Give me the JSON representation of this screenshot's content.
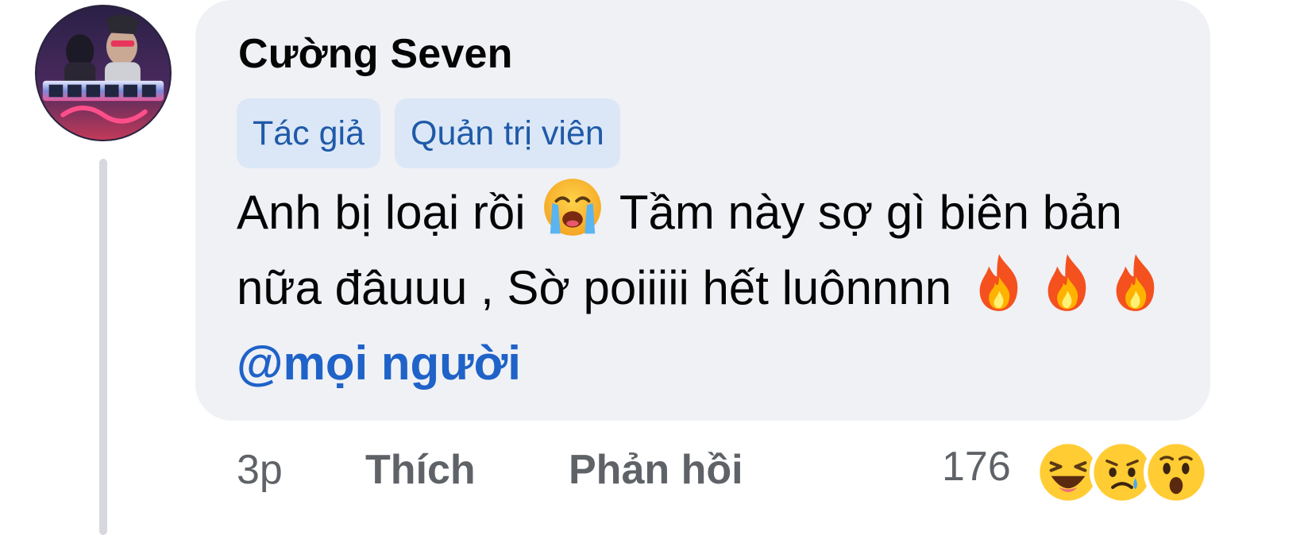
{
  "comment": {
    "author": "Cường Seven",
    "badges": [
      "Tác giả",
      "Quản trị viên"
    ],
    "text_part1": "Anh bị loại rồi",
    "text_part2": "Tầm này sợ gì biên bản nữa đâuuu , Sờ poiiiii hết luônnnn",
    "mention": "@mọi người",
    "inline_emojis": [
      "crying-face",
      "fire",
      "fire",
      "fire"
    ]
  },
  "footer": {
    "time": "3p",
    "like_label": "Thích",
    "reply_label": "Phản hồi",
    "reaction_count": "176",
    "reactions": [
      "haha-icon",
      "sad-icon",
      "wow-icon"
    ]
  },
  "colors": {
    "bubble_bg": "#eff1f5",
    "badge_bg": "#dbe7f7",
    "badge_text": "#1f5aa8",
    "mention": "#1f62c8",
    "meta_text": "#5f6368"
  }
}
